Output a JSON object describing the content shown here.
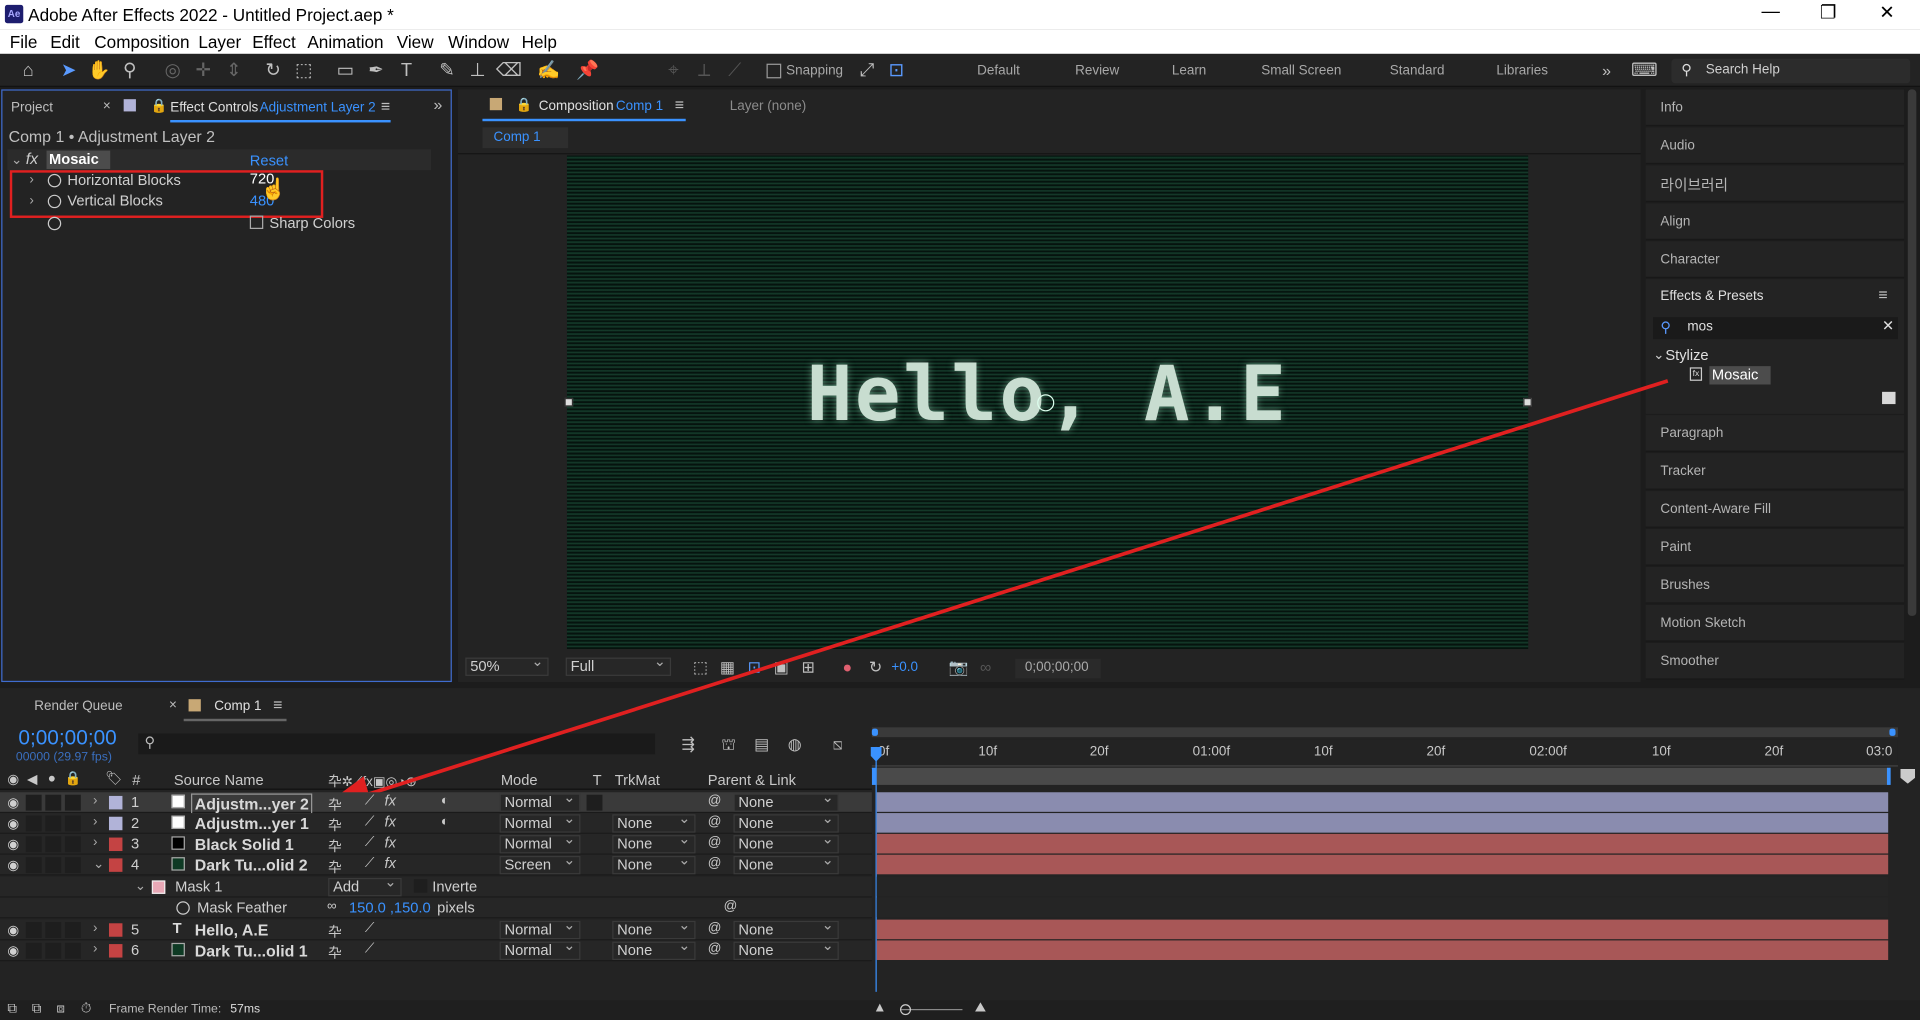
{
  "window": {
    "title": "Adobe After Effects 2022 - Untitled Project.aep *",
    "app_icon": "Ae"
  },
  "menu": [
    "File",
    "Edit",
    "Composition",
    "Layer",
    "Effect",
    "Animation",
    "View",
    "Window",
    "Help"
  ],
  "toolbar": {
    "snapping": "Snapping",
    "workspaces": [
      "Default",
      "Review",
      "Learn",
      "Small Screen",
      "Standard",
      "Libraries"
    ],
    "search_help": "Search Help"
  },
  "effect_controls": {
    "tab_project": "Project",
    "tab_label": "Effect Controls",
    "tab_layer": "Adjustment Layer 2",
    "path": "Comp 1 • Adjustment Layer 2",
    "effect_name": "Mosaic",
    "reset": "Reset",
    "horizontal_label": "Horizontal Blocks",
    "horizontal_value": "720",
    "vertical_label": "Vertical Blocks",
    "vertical_value": "480",
    "sharp_colors": "Sharp Colors"
  },
  "composition": {
    "tab_label": "Composition",
    "tab_comp": "Comp 1",
    "layer_tab": "Layer (none)",
    "comp_button": "Comp 1",
    "text": "Hello, A.E",
    "zoom": "50%",
    "resolution": "Full",
    "exposure": "+0.0",
    "timecode": "0;00;00;00"
  },
  "right_panel": {
    "items_top": [
      "Info",
      "Audio",
      "라이브러리",
      "Align",
      "Character"
    ],
    "effects_presets": "Effects & Presets",
    "search_value": "mos",
    "category": "Stylize",
    "result": "Mosaic",
    "items_bottom": [
      "Paragraph",
      "Tracker",
      "Content-Aware Fill",
      "Paint",
      "Brushes",
      "Motion Sketch",
      "Smoother"
    ]
  },
  "timeline": {
    "tab_render": "Render Queue",
    "tab_comp": "Comp 1",
    "timecode": "0;00;00;00",
    "fps": "00000 (29.97 fps)",
    "ruler": [
      "0f",
      "10f",
      "20f",
      "01:00f",
      "10f",
      "20f",
      "02:00f",
      "10f",
      "20f",
      "03:0"
    ],
    "headers": {
      "num": "#",
      "source": "Source Name",
      "mode": "Mode",
      "t": "T",
      "trkmat": "TrkMat",
      "parent": "Parent & Link"
    },
    "layers": [
      {
        "num": "1",
        "name": "Adjustm...yer 2",
        "mode": "Normal",
        "trkmat": "",
        "parent": "None",
        "color": "#b1b3d8",
        "icon": "#ffffff",
        "bar": "#8a8caf"
      },
      {
        "num": "2",
        "name": "Adjustm...yer 1",
        "mode": "Normal",
        "trkmat": "None",
        "parent": "None",
        "color": "#b1b3d8",
        "icon": "#ffffff",
        "bar": "#8a8caf"
      },
      {
        "num": "3",
        "name": "Black Solid 1",
        "mode": "Normal",
        "trkmat": "None",
        "parent": "None",
        "color": "#c44343",
        "icon": "#000000",
        "bar": "#a85757"
      },
      {
        "num": "4",
        "name": "Dark Tu...olid 2",
        "mode": "Screen",
        "trkmat": "None",
        "parent": "None",
        "color": "#c44343",
        "icon": "#0e3a24",
        "bar": "#a85757"
      },
      {
        "num": "5",
        "name": "Hello, A.E",
        "mode": "Normal",
        "trkmat": "None",
        "parent": "None",
        "color": "#c44343",
        "icon": "T",
        "bar": "#a85757"
      },
      {
        "num": "6",
        "name": "Dark Tu...olid 1",
        "mode": "Normal",
        "trkmat": "None",
        "parent": "None",
        "color": "#c44343",
        "icon": "#0e3a24",
        "bar": "#a85757"
      }
    ],
    "mask": {
      "name": "Mask 1",
      "mode": "Add",
      "inverted": "Inverte",
      "feather_label": "Mask Feather",
      "feather_value": "150.0 ,150.0",
      "feather_unit": "pixels"
    },
    "status": "Frame Render Time:",
    "render_time": "57ms"
  }
}
